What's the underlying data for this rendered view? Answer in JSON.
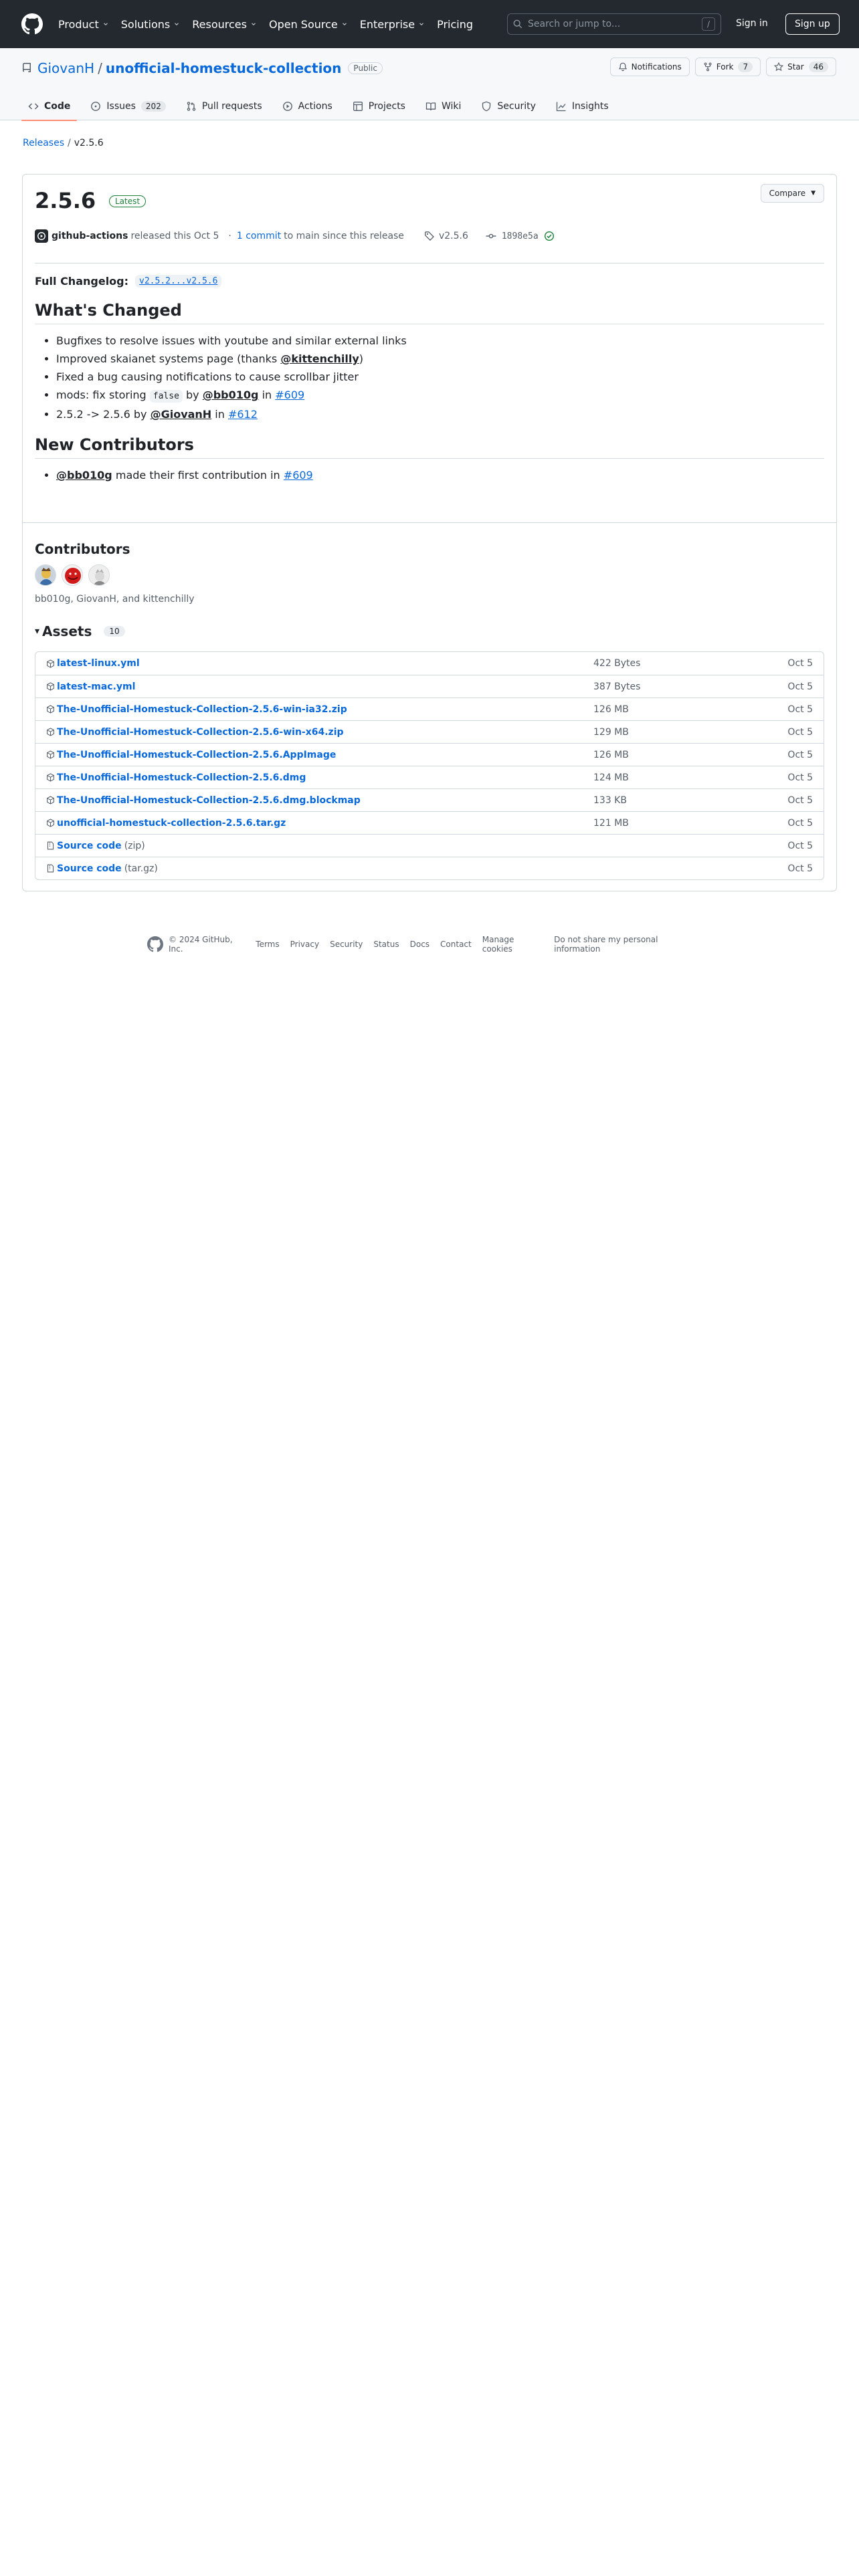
{
  "header": {
    "nav": [
      {
        "label": "Product",
        "caret": true
      },
      {
        "label": "Solutions",
        "caret": true
      },
      {
        "label": "Resources",
        "caret": true
      },
      {
        "label": "Open Source",
        "caret": true
      },
      {
        "label": "Enterprise",
        "caret": true
      },
      {
        "label": "Pricing",
        "caret": false
      }
    ],
    "search_placeholder": "Search or jump to...",
    "search_key": "/",
    "signin": "Sign in",
    "signup": "Sign up"
  },
  "repo": {
    "owner": "GiovanH",
    "sep": "/",
    "name": "unofficial-homestuck-collection",
    "visibility": "Public",
    "notifications_label": "Notifications",
    "fork_label": "Fork",
    "fork_count": "7",
    "star_label": "Star",
    "star_count": "46",
    "tabs": [
      {
        "label": "Code",
        "icon": "code-icon",
        "count": "",
        "active": true
      },
      {
        "label": "Issues",
        "icon": "issue-icon",
        "count": "202",
        "active": false
      },
      {
        "label": "Pull requests",
        "icon": "pull-request-icon",
        "count": "",
        "active": false
      },
      {
        "label": "Actions",
        "icon": "play-icon",
        "count": "",
        "active": false
      },
      {
        "label": "Projects",
        "icon": "table-icon",
        "count": "",
        "active": false
      },
      {
        "label": "Wiki",
        "icon": "book-icon",
        "count": "",
        "active": false
      },
      {
        "label": "Security",
        "icon": "shield-icon",
        "count": "",
        "active": false
      },
      {
        "label": "Insights",
        "icon": "graph-icon",
        "count": "",
        "active": false
      }
    ]
  },
  "breadcrumb": {
    "parent": "Releases",
    "sep": "/",
    "current": "v2.5.6"
  },
  "release": {
    "title": "2.5.6",
    "badge": "Latest",
    "compare": "Compare",
    "author": "github-actions",
    "released_text": "released this Oct 5",
    "dot": "·",
    "commits_link": "1 commit",
    "commits_text": "to main since this release",
    "tag": "v2.5.6",
    "sha": "1898e5a",
    "full_changelog_label": "Full Changelog",
    "full_changelog_colon": ":",
    "full_changelog_link": "v2.5.2...v2.5.6",
    "whats_changed": "What's Changed",
    "changes": {
      "c1": "Bugfixes to resolve issues with youtube and similar external links",
      "c2_a": "Improved skaianet systems page (thanks ",
      "c2_mention": "@kittenchilly",
      "c2_b": ")",
      "c3": "Fixed a bug causing notifications to cause scrollbar jitter",
      "c4_a": "mods: fix storing ",
      "c4_code": "false",
      "c4_b": " by ",
      "c4_mention": "@bb010g",
      "c4_c": " in ",
      "c4_issue": "#609",
      "c5_a": "2.5.2 -> 2.5.6 by ",
      "c5_mention": "@GiovanH",
      "c5_b": " in ",
      "c5_issue": "#612"
    },
    "new_contributors": "New Contributors",
    "nc": {
      "mention": "@bb010g",
      "text": " made their first contribution in ",
      "issue": "#609"
    },
    "contributors_title": "Contributors",
    "contributors_names": "bb010g, GiovanH, and kittenchilly",
    "assets_title": "Assets",
    "assets_toggle": "▾",
    "assets_count": "10",
    "assets": [
      {
        "name": "latest-linux.yml",
        "sub": "",
        "size": "422 Bytes",
        "date": "Oct 5",
        "icon": "package-icon"
      },
      {
        "name": "latest-mac.yml",
        "sub": "",
        "size": "387 Bytes",
        "date": "Oct 5",
        "icon": "package-icon"
      },
      {
        "name": "The-Unofficial-Homestuck-Collection-2.5.6-win-ia32.zip",
        "sub": "",
        "size": "126 MB",
        "date": "Oct 5",
        "icon": "package-icon"
      },
      {
        "name": "The-Unofficial-Homestuck-Collection-2.5.6-win-x64.zip",
        "sub": "",
        "size": "129 MB",
        "date": "Oct 5",
        "icon": "package-icon"
      },
      {
        "name": "The-Unofficial-Homestuck-Collection-2.5.6.AppImage",
        "sub": "",
        "size": "126 MB",
        "date": "Oct 5",
        "icon": "package-icon"
      },
      {
        "name": "The-Unofficial-Homestuck-Collection-2.5.6.dmg",
        "sub": "",
        "size": "124 MB",
        "date": "Oct 5",
        "icon": "package-icon"
      },
      {
        "name": "The-Unofficial-Homestuck-Collection-2.5.6.dmg.blockmap",
        "sub": "",
        "size": "133 KB",
        "date": "Oct 5",
        "icon": "package-icon"
      },
      {
        "name": "unofficial-homestuck-collection-2.5.6.tar.gz",
        "sub": "",
        "size": "121 MB",
        "date": "Oct 5",
        "icon": "package-icon"
      },
      {
        "name": "Source code",
        "sub": "(zip)",
        "size": "",
        "date": "Oct 5",
        "icon": "file-zip-icon"
      },
      {
        "name": "Source code",
        "sub": "(tar.gz)",
        "size": "",
        "date": "Oct 5",
        "icon": "file-zip-icon"
      }
    ]
  },
  "footer": {
    "copyright": "© 2024 GitHub, Inc.",
    "links": [
      "Terms",
      "Privacy",
      "Security",
      "Status",
      "Docs",
      "Contact",
      "Manage cookies",
      "Do not share my personal information"
    ]
  },
  "colors": {
    "header_bg": "#24292f",
    "link": "#0969da",
    "latest": "#1a7f37",
    "tab_underline": "#fd8c73"
  }
}
